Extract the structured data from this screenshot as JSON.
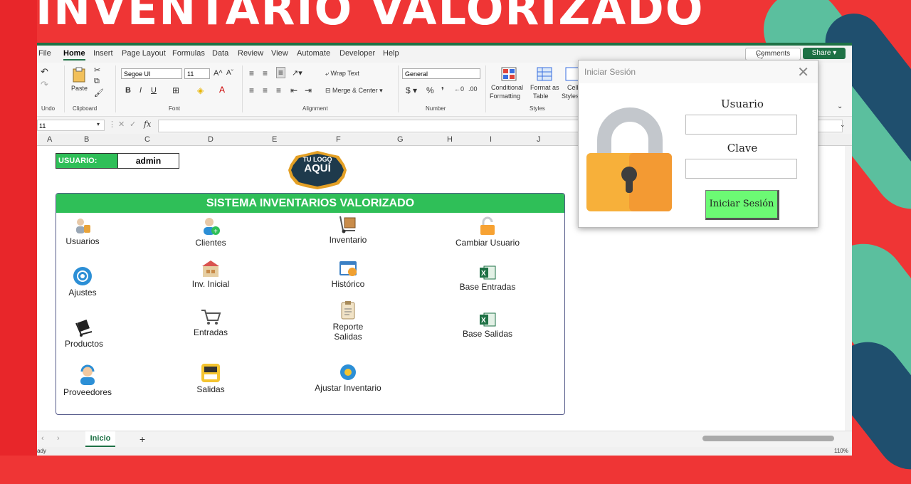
{
  "banner": {
    "title": "INVENTARIO VALORIZADO"
  },
  "menu": {
    "tabs": [
      "File",
      "Home",
      "Insert",
      "Page Layout",
      "Formulas",
      "Data",
      "Review",
      "View",
      "Automate",
      "Developer",
      "Help"
    ],
    "comments": "Comments",
    "share": "Share"
  },
  "ribbon": {
    "undo": "Undo",
    "clipboard": "Clipboard",
    "paste": "Paste",
    "font": "Font",
    "font_name": "Segoe UI",
    "font_size": "11",
    "alignment": "Alignment",
    "wrap_text": "Wrap Text",
    "merge_center": "Merge & Center",
    "number": "Number",
    "number_format": "General",
    "styles": "Styles",
    "conditional_formatting_1": "Conditional",
    "conditional_formatting_2": "Formatting",
    "format_table_1": "Format as",
    "format_table_2": "Table",
    "cell_styles_1": "Cell",
    "cell_styles_2": "Styles"
  },
  "formula_bar": {
    "name_box": "11",
    "fx": "fx"
  },
  "columns": [
    "A",
    "B",
    "C",
    "D",
    "E",
    "F",
    "G",
    "H",
    "I",
    "J"
  ],
  "sheet": {
    "usuario_label": "USUARIO:",
    "usuario_value": "admin",
    "logo_line1": "TU LOGO",
    "logo_line2": "AQUÍ",
    "panel_title": "SISTEMA INVENTARIOS VALORIZADO",
    "menu_items": {
      "usuarios": "Usuarios",
      "clientes": "Clientes",
      "inventario": "Inventario",
      "cambiar_usuario": "Cambiar Usuario",
      "ajustes": "Ajustes",
      "inv_inicial": "Inv. Inicial",
      "historico": "Histórico",
      "base_entradas": "Base Entradas",
      "productos": "Productos",
      "entradas": "Entradas",
      "reporte_salidas_1": "Reporte",
      "reporte_salidas_2": "Salidas",
      "base_salidas": "Base Salidas",
      "proveedores": "Proveedores",
      "salidas": "Salidas",
      "ajustar_inventario": "Ajustar Inventario"
    }
  },
  "sheet_tabs": {
    "active": "Inicio",
    "add": "+"
  },
  "status": {
    "ready": "ady",
    "zoom": "110%"
  },
  "login_dialog": {
    "title": "Iniciar Sesión",
    "close": "✕",
    "usuario_label": "Usuario",
    "usuario_value": "",
    "clave_label": "Clave",
    "clave_value": "",
    "submit": "Iniciar Sesión"
  },
  "colors": {
    "green": "#2fbf58",
    "excel_green": "#1e7145",
    "background_red": "#ef3535",
    "button_green": "#6cfa74"
  }
}
